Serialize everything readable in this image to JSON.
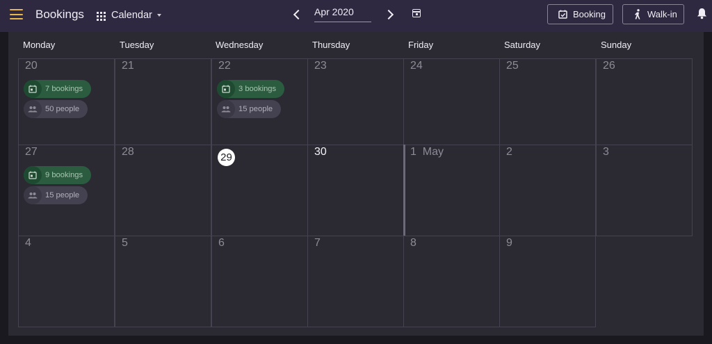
{
  "header": {
    "app_title": "Bookings",
    "view_label": "Calendar",
    "month_value": "Apr 2020",
    "booking_button": "Booking",
    "walkin_button": "Walk-in"
  },
  "weekdays": [
    "Monday",
    "Tuesday",
    "Wednesday",
    "Thursday",
    "Friday",
    "Saturday",
    "Sunday"
  ],
  "weeks": [
    [
      {
        "day": "20",
        "bookings": "7 bookings",
        "people": "50 people"
      },
      {
        "day": "21"
      },
      {
        "day": "22",
        "bookings": "3 bookings",
        "people": "15 people"
      },
      {
        "day": "23"
      },
      {
        "day": "24"
      },
      {
        "day": "25"
      },
      {
        "day": "26"
      }
    ],
    [
      {
        "day": "27",
        "bookings": "9 bookings",
        "people": "15 people"
      },
      {
        "day": "28"
      },
      {
        "day": "29",
        "today": true
      },
      {
        "day": "30",
        "current": true
      },
      {
        "day": "1  May"
      },
      {
        "day": "2"
      },
      {
        "day": "3"
      }
    ],
    [
      {
        "day": "4"
      },
      {
        "day": "5"
      },
      {
        "day": "6"
      },
      {
        "day": "7"
      },
      {
        "day": "8"
      },
      {
        "day": "9"
      }
    ]
  ],
  "colors": {
    "topbar": "#2e2840",
    "accent": "#e9b84a",
    "bookings_chip": "#2b5c40",
    "people_chip": "#444250"
  }
}
